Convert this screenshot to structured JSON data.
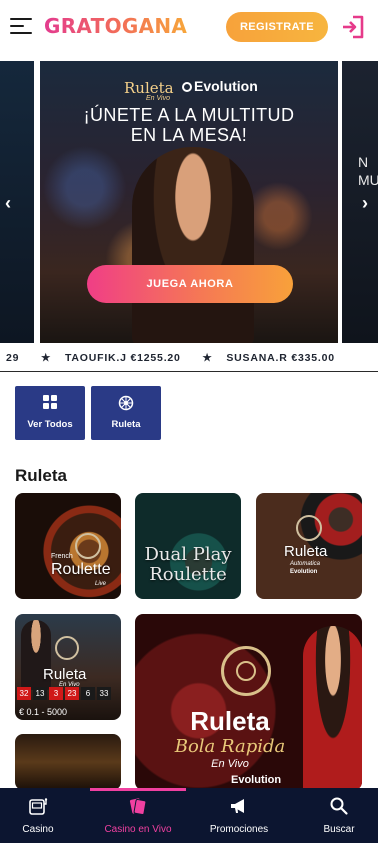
{
  "header": {
    "logo": "GRATOGANA",
    "register_label": "REGISTRATE"
  },
  "banner": {
    "brand_game": "Ruleta",
    "brand_en_vivo": "En Vivo",
    "brand_provider": "Evolution",
    "headline_line1": "¡ÚNETE A LA MULTITUD",
    "headline_line2": "EN LA MESA!",
    "cta_label": "JUEGA AHORA",
    "next_slide_peek": "N\nMU",
    "prev_arrow": "‹",
    "next_arrow": "›"
  },
  "ticker": {
    "items": [
      {
        "name": "29",
        "amount": ""
      },
      {
        "name": "TAOUFIK.J",
        "amount": "€1255.20"
      },
      {
        "name": "SUSANA.R",
        "amount": "€335.00"
      }
    ]
  },
  "filters": [
    {
      "label": "Ver Todos",
      "icon": "grid-icon"
    },
    {
      "label": "Ruleta",
      "icon": "roulette-icon"
    }
  ],
  "section": {
    "title": "Ruleta"
  },
  "games": {
    "french": {
      "sub": "French",
      "title": "Roulette",
      "sub2": "Live"
    },
    "dual": {
      "title_line1": "Dual Play",
      "title_line2": "Roulette"
    },
    "auto": {
      "title": "Ruleta",
      "sub": "Automatica",
      "provider": "Evolution"
    },
    "live": {
      "title": "Ruleta",
      "sub": "En Vivo",
      "numbers": [
        {
          "n": "32",
          "color": "red"
        },
        {
          "n": "13",
          "color": "black"
        },
        {
          "n": "3",
          "color": "red"
        },
        {
          "n": "23",
          "color": "red"
        },
        {
          "n": "6",
          "color": "black"
        },
        {
          "n": "33",
          "color": "black"
        }
      ],
      "limit": "€ 0.1 - 5000"
    },
    "rapida": {
      "title": "Ruleta",
      "sub": "Bola Rapida",
      "sub2": "En Vivo",
      "provider": "Evolution"
    }
  },
  "bottom_nav": [
    {
      "label": "Casino",
      "icon": "slot-machine-icon"
    },
    {
      "label": "Casino en Vivo",
      "icon": "cards-icon",
      "active": true
    },
    {
      "label": "Promociones",
      "icon": "megaphone-icon"
    },
    {
      "label": "Buscar",
      "icon": "search-icon"
    }
  ],
  "colors": {
    "accent_pink": "#f040a0",
    "register_orange": "#f7a23b",
    "chip_blue": "#2a3a86",
    "nav_bg": "#0c1530"
  }
}
